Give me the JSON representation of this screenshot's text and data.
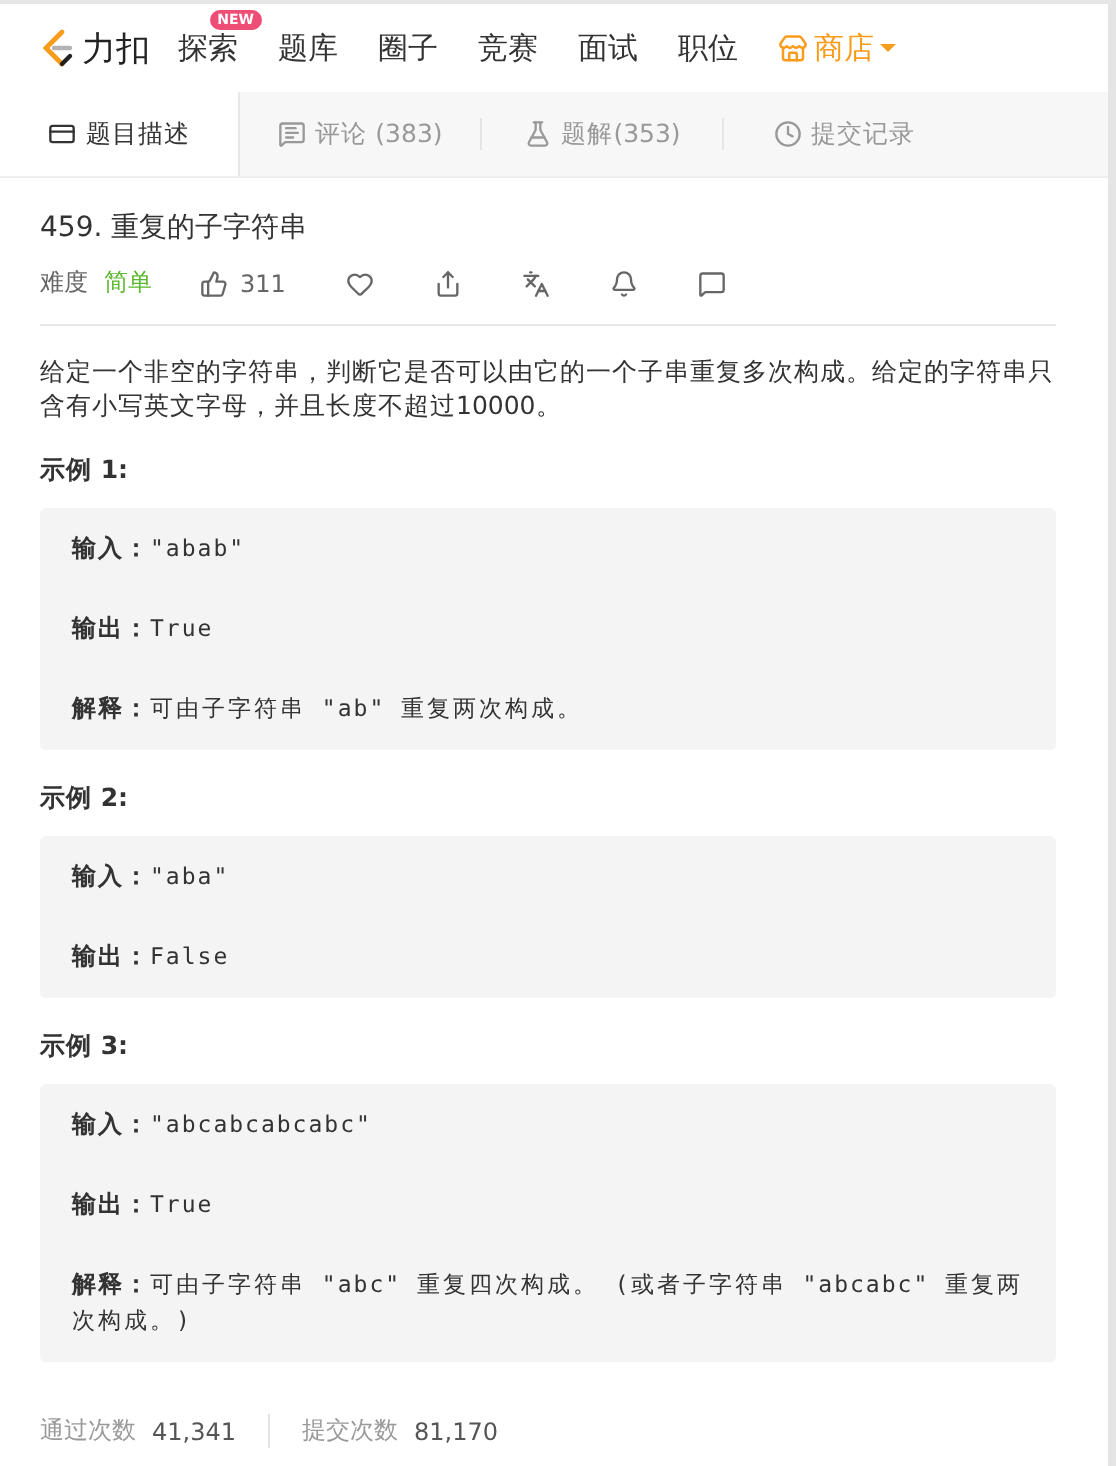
{
  "nav": {
    "brand": "力扣",
    "items": [
      {
        "label": "探索",
        "badge": "NEW",
        "kind": "link"
      },
      {
        "label": "题库",
        "kind": "link"
      },
      {
        "label": "圈子",
        "kind": "link"
      },
      {
        "label": "竞赛",
        "kind": "link"
      },
      {
        "label": "面试",
        "kind": "link"
      },
      {
        "label": "职位",
        "kind": "link"
      },
      {
        "label": "商店",
        "kind": "store"
      }
    ]
  },
  "tabs": [
    {
      "label": "题目描述",
      "kind": "description",
      "selected": true
    },
    {
      "label": "评论 (383)",
      "kind": "comments",
      "selected": false
    },
    {
      "label": "题解(353)",
      "kind": "solutions",
      "selected": false
    },
    {
      "label": "提交记录",
      "kind": "submissions",
      "selected": false
    }
  ],
  "problem": {
    "title": "459. 重复的子字符串",
    "difficulty_label": "难度",
    "difficulty": "简单",
    "likes": "311",
    "description": "给定一个非空的字符串，判断它是否可以由它的一个子串重复多次构成。给定的字符串只含有小写英文字母，并且长度不超过10000。"
  },
  "examples": [
    {
      "heading": "示例 1:",
      "lines": [
        {
          "label": "输入：",
          "value": "\"abab\""
        },
        {
          "label": "输出：",
          "value": "True"
        },
        {
          "label": "解释：",
          "value": "可由子字符串 \"ab\" 重复两次构成。"
        }
      ]
    },
    {
      "heading": "示例 2:",
      "lines": [
        {
          "label": "输入：",
          "value": "\"aba\""
        },
        {
          "label": "输出：",
          "value": "False"
        }
      ]
    },
    {
      "heading": "示例 3:",
      "lines": [
        {
          "label": "输入：",
          "value": "\"abcabcabcabc\""
        },
        {
          "label": "输出：",
          "value": "True"
        },
        {
          "label": "解释：",
          "value": "可由子字符串 \"abc\" 重复四次构成。 (或者子字符串 \"abcabc\" 重复两次构成。)"
        }
      ]
    }
  ],
  "stats": [
    {
      "label": "通过次数",
      "value": "41,341"
    },
    {
      "label": "提交次数",
      "value": "81,170"
    }
  ]
}
